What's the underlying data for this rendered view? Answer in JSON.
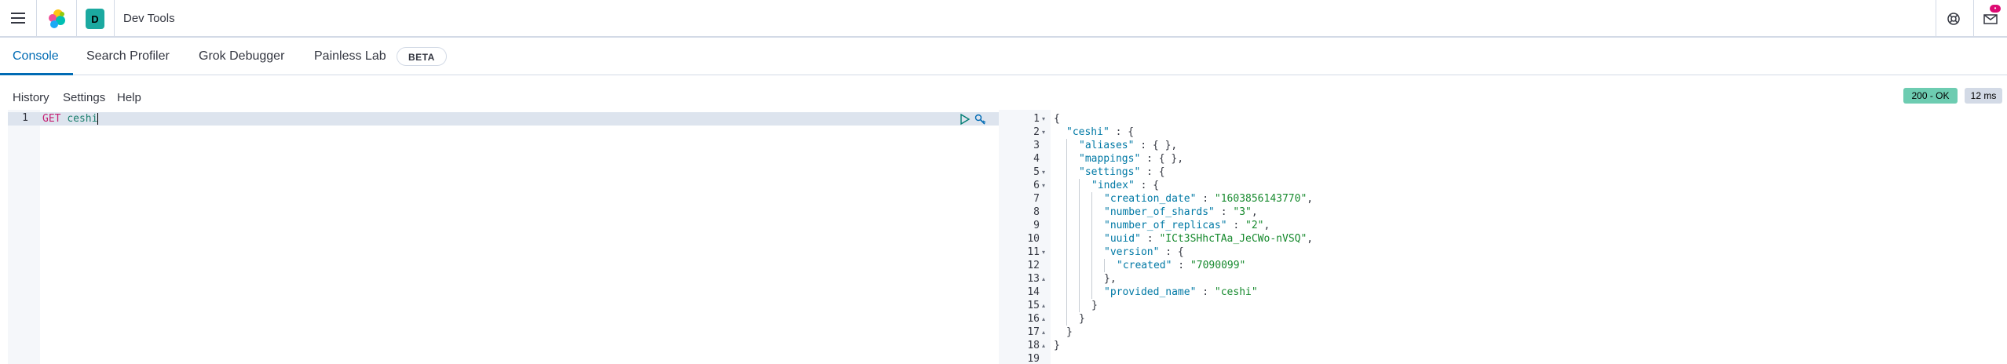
{
  "header": {
    "space_initial": "D",
    "app_title": "Dev Tools",
    "notification_count": "•",
    "icons": [
      "menu-icon",
      "elastic-logo-icon",
      "help-icon",
      "newsfeed-icon"
    ]
  },
  "tabs": [
    {
      "label": "Console",
      "active": true
    },
    {
      "label": "Search Profiler",
      "active": false
    },
    {
      "label": "Grok Debugger",
      "active": false
    },
    {
      "label": "Painless Lab",
      "active": false
    }
  ],
  "beta_badge": "BETA",
  "console_menu": {
    "history": "History",
    "settings": "Settings",
    "help": "Help"
  },
  "response_status": {
    "code": "200 - OK",
    "time": "12 ms",
    "code_color": "#6dccb1",
    "time_color": "#d3dae6"
  },
  "request_editor": {
    "line_number": "1",
    "method": "GET",
    "path": "ceshi"
  },
  "response_lines": [
    {
      "n": "1",
      "indent": 0,
      "k": "",
      "rest": "{"
    },
    {
      "n": "2",
      "indent": 1,
      "k": "\"ceshi\"",
      "rest": " : {"
    },
    {
      "n": "3",
      "indent": 2,
      "k": "\"aliases\"",
      "rest": " : { },"
    },
    {
      "n": "4",
      "indent": 2,
      "k": "\"mappings\"",
      "rest": " : { },"
    },
    {
      "n": "5",
      "indent": 2,
      "k": "\"settings\"",
      "rest": " : {"
    },
    {
      "n": "6",
      "indent": 3,
      "k": "\"index\"",
      "rest": " : {"
    },
    {
      "n": "7",
      "indent": 4,
      "k": "\"creation_date\"",
      "sep": " : ",
      "s": "\"1603856143770\"",
      "end": ","
    },
    {
      "n": "8",
      "indent": 4,
      "k": "\"number_of_shards\"",
      "sep": " : ",
      "s": "\"3\"",
      "end": ","
    },
    {
      "n": "9",
      "indent": 4,
      "k": "\"number_of_replicas\"",
      "sep": " : ",
      "s": "\"2\"",
      "end": ","
    },
    {
      "n": "10",
      "indent": 4,
      "k": "\"uuid\"",
      "sep": " : ",
      "s": "\"ICt3SHhcTAa_JeCWo-nVSQ\"",
      "end": ","
    },
    {
      "n": "11",
      "indent": 4,
      "k": "\"version\"",
      "rest": " : {"
    },
    {
      "n": "12",
      "indent": 5,
      "k": "\"created\"",
      "sep": " : ",
      "s": "\"7090099\"",
      "end": ""
    },
    {
      "n": "13",
      "indent": 4,
      "k": "",
      "rest": "},"
    },
    {
      "n": "14",
      "indent": 4,
      "k": "\"provided_name\"",
      "sep": " : ",
      "s": "\"ceshi\"",
      "end": ""
    },
    {
      "n": "15",
      "indent": 3,
      "k": "",
      "rest": "}"
    },
    {
      "n": "16",
      "indent": 2,
      "k": "",
      "rest": "}"
    },
    {
      "n": "17",
      "indent": 1,
      "k": "",
      "rest": "}"
    },
    {
      "n": "18",
      "indent": 0,
      "k": "",
      "rest": "}"
    },
    {
      "n": "19",
      "indent": 0,
      "k": "",
      "rest": ""
    }
  ]
}
